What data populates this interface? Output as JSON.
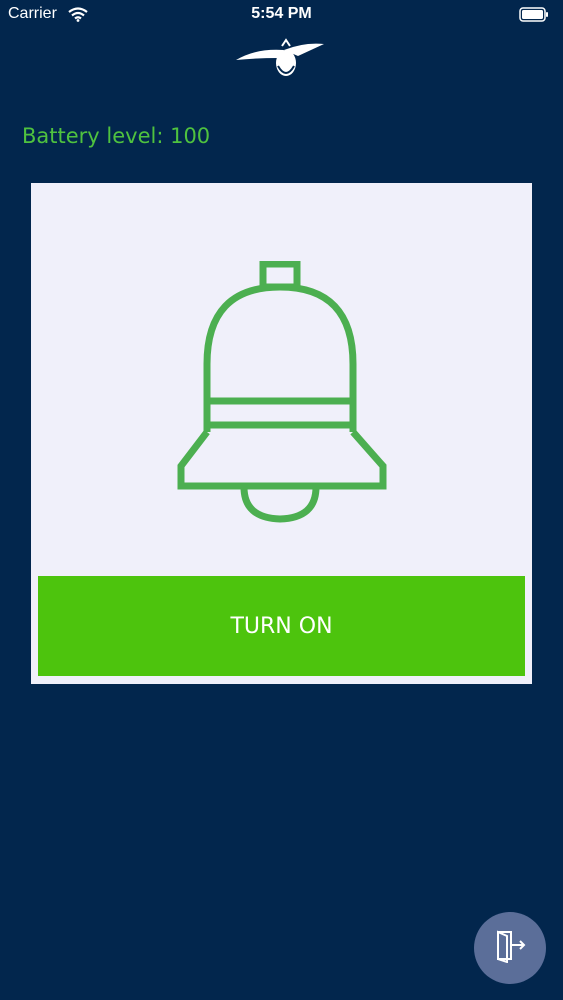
{
  "status_bar": {
    "carrier": "Carrier",
    "time": "5:54 PM",
    "icons": [
      "wifi-icon",
      "battery-icon"
    ]
  },
  "header": {
    "logo_icon": "firefly-logo-icon"
  },
  "battery": {
    "label": "Battery level: 100"
  },
  "alarm": {
    "icon": "bell-icon",
    "button_label": "TURN ON"
  },
  "footer": {
    "logout_icon": "exit-door-icon"
  },
  "colors": {
    "background": "#02264d",
    "accent_green": "#4dc40d",
    "bell_green": "#4caf50",
    "text_green": "#4fc23f",
    "card": "#f0f0fa",
    "fab": "#5b6e99"
  }
}
